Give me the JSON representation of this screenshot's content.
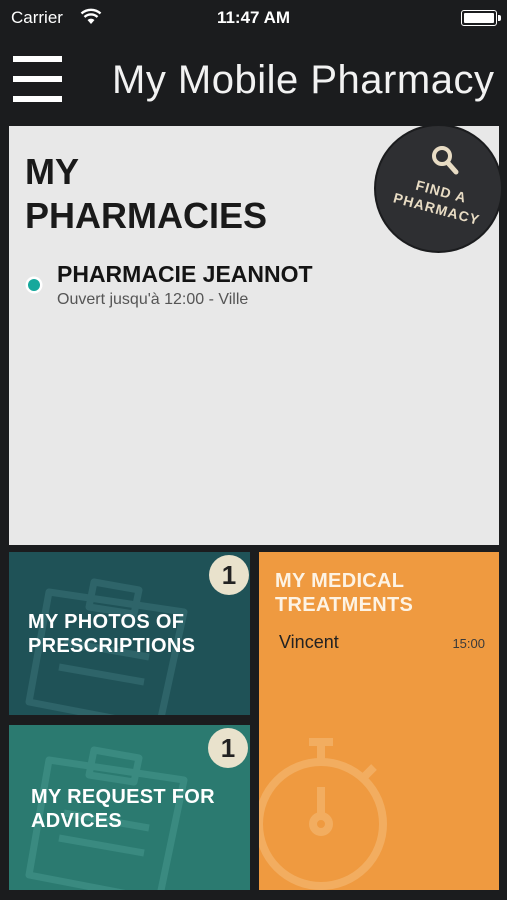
{
  "status_bar": {
    "carrier": "Carrier",
    "time": "11:47 AM"
  },
  "header": {
    "title": "My Mobile Pharmacy",
    "menu_icon": "hamburger-menu-icon"
  },
  "pharmacies": {
    "title_line1": "MY",
    "title_line2": "PHARMACIES",
    "find_button": {
      "line1": "FIND A",
      "line2": "PHARMACY",
      "icon": "search-icon"
    },
    "items": [
      {
        "name": "PHARMACIE JEANNOT",
        "hours": "Ouvert jusqu'à 12:00 - Ville",
        "status_color": "#16a89c"
      }
    ]
  },
  "tiles": {
    "photos": {
      "label_line1": "MY PHOTOS OF",
      "label_line2": "PRESCRIPTIONS",
      "badge": "1",
      "color": "#1f5257",
      "icon": "clipboard-icon"
    },
    "advice": {
      "label_line1": "MY REQUEST FOR",
      "label_line2": "ADVICES",
      "badge": "1",
      "color": "#2b7a70",
      "icon": "clipboard-icon"
    },
    "treatments": {
      "label_line1": "MY MEDICAL",
      "label_line2": "TREATMENTS",
      "color": "#ef9a40",
      "icon": "stopwatch-icon",
      "entries": [
        {
          "name": "Vincent",
          "time": "15:00"
        }
      ]
    }
  }
}
